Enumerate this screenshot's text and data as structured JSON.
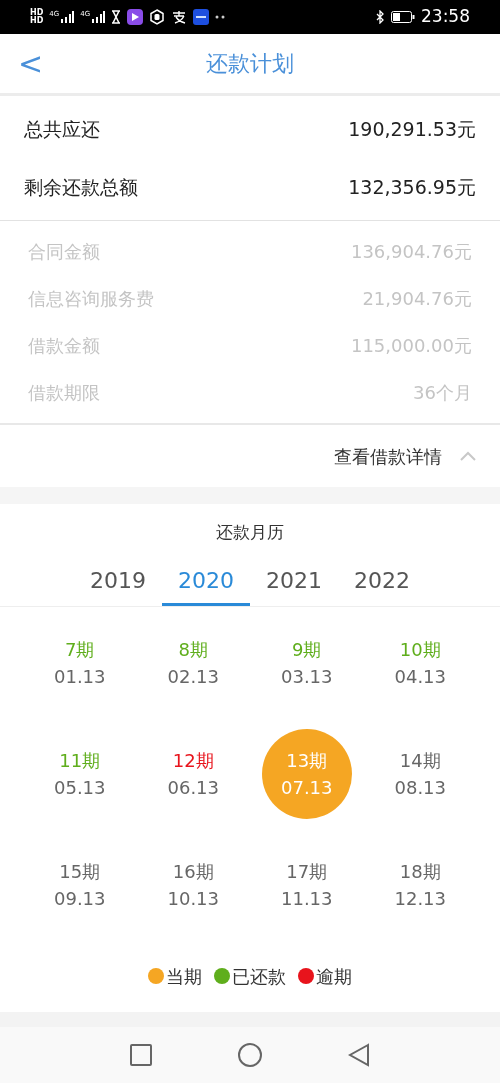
{
  "status_bar": {
    "sim_labels": [
      "HD",
      "HD"
    ],
    "network_labels": [
      "4G",
      "4G"
    ],
    "time": "23:58"
  },
  "header": {
    "back": "<",
    "title": "还款计划"
  },
  "summary": [
    {
      "label": "总共应还",
      "value": "190,291.53元"
    },
    {
      "label": "剩余还款总额",
      "value": "132,356.95元"
    }
  ],
  "details": [
    {
      "label": "合同金额",
      "value": "136,904.76元"
    },
    {
      "label": "信息咨询服务费",
      "value": "21,904.76元"
    },
    {
      "label": "借款金额",
      "value": "115,000.00元"
    },
    {
      "label": "借款期限",
      "value": "36个月"
    }
  ],
  "details_toggle": {
    "label": "查看借款详情",
    "expanded": true
  },
  "calendar": {
    "title": "还款月历",
    "years": [
      {
        "label": "2019",
        "selected": false
      },
      {
        "label": "2020",
        "selected": true
      },
      {
        "label": "2021",
        "selected": false
      },
      {
        "label": "2022",
        "selected": false
      }
    ],
    "periods": [
      {
        "period": "7期",
        "date": "01.13",
        "kind": "paid"
      },
      {
        "period": "8期",
        "date": "02.13",
        "kind": "paid"
      },
      {
        "period": "9期",
        "date": "03.13",
        "kind": "paid"
      },
      {
        "period": "10期",
        "date": "04.13",
        "kind": "paid"
      },
      {
        "period": "11期",
        "date": "05.13",
        "kind": "paid"
      },
      {
        "period": "12期",
        "date": "06.13",
        "kind": "overdue"
      },
      {
        "period": "13期",
        "date": "07.13",
        "kind": "current"
      },
      {
        "period": "14期",
        "date": "08.13",
        "kind": "upcoming"
      },
      {
        "period": "15期",
        "date": "09.13",
        "kind": "upcoming"
      },
      {
        "period": "16期",
        "date": "10.13",
        "kind": "upcoming"
      },
      {
        "period": "17期",
        "date": "11.13",
        "kind": "upcoming"
      },
      {
        "period": "18期",
        "date": "12.13",
        "kind": "upcoming"
      }
    ],
    "legend": [
      {
        "label": "当期",
        "color": "#f5a623"
      },
      {
        "label": "已还款",
        "color": "#5fae1c"
      },
      {
        "label": "逾期",
        "color": "#e8141c"
      }
    ]
  }
}
